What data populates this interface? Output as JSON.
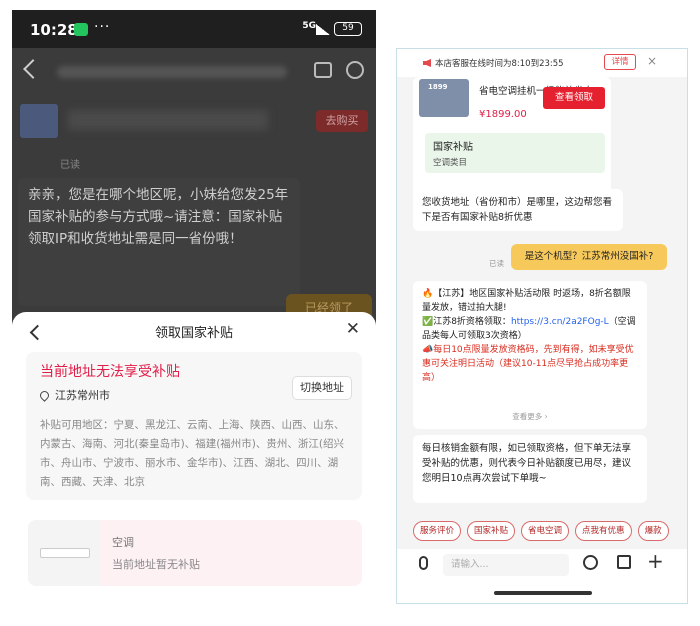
{
  "left": {
    "status": {
      "time": "10:28",
      "dots": "···",
      "net": "5G",
      "battery": "59"
    },
    "dim_chat": {
      "buy": "去购买",
      "read": "已读",
      "message": "亲亲，您是在哪个地区呢，小妹给您发25年国家补贴的参与方式哦~请注意：国家补贴领取IP和收货地址需是同一省份哦！",
      "pill": "已经领了"
    },
    "sheet": {
      "title": "领取国家补贴",
      "warning": "当前地址无法享受补贴",
      "address": "江苏常州市",
      "switch_btn": "切换地址",
      "areas": "补贴可用地区：宁夏、黑龙江、云南、上海、陕西、山西、山东、内蒙古、海南、河北(秦皇岛市)、福建(福州市)、贵州、浙江(绍兴市、舟山市、宁波市、丽水市、金华市)、江西、湖北、四川、湖南、西藏、天津、北京",
      "product_name": "空调",
      "product_note": "当前地址暂无补贴"
    }
  },
  "right": {
    "notice": "本店客服在线时间为8:10到23:55",
    "detail_btn": "详情",
    "close": "×",
    "product": {
      "img_price": "1899",
      "title": "省电空调挂机一级能效省电...",
      "price": "¥1899.00"
    },
    "subsidy": {
      "title": "国家补贴",
      "category": "空调类目",
      "claim": "查看领取"
    },
    "msg1": "您收货地址（省份和市）是哪里，这边帮您看下是否有国家补贴8折优惠",
    "read": "已读",
    "user_msg": "是这个机型？江苏常州没国补?",
    "msg2": {
      "l1": "🔥【江苏】地区国家补贴活动限 时返场，8折名额限量发放，错过拍大腿!",
      "l2a": "✅江苏8折资格领取：",
      "l2link": "https://3.cn/2a2FOg-L",
      "l2b": "（空调品类每人可领取3次资格）",
      "l3": "📣每日10点限量发放资格码，先到有得，如未享受优惠可关注明日活动（建议10-11点尽早抢占成功率更高）",
      "more": "查看更多 ›"
    },
    "msg3": "每日核销金额有限，如已领取资格，但下单无法享受补贴的优惠，则代表今日补贴额度已用尽，建议您明日10点再次尝试下单哦~",
    "chips": [
      "服务评价",
      "国家补贴",
      "省电空调",
      "点我有优惠",
      "爆款"
    ],
    "input_placeholder": "请输入...",
    "plus": "+"
  }
}
